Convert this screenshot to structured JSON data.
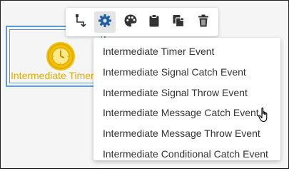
{
  "canvas": {
    "node_label": "Intermediate Timer Event",
    "node_color": "#f2c200",
    "selection_color": "#5b9bd5"
  },
  "toolbar": {
    "buttons": [
      {
        "icon": "flow-connector-icon"
      },
      {
        "icon": "gear-icon",
        "active": true
      },
      {
        "icon": "palette-icon"
      },
      {
        "icon": "clipboard-icon"
      },
      {
        "icon": "copy-icon"
      },
      {
        "icon": "trash-icon"
      }
    ]
  },
  "menu": {
    "items": [
      "Intermediate Timer Event",
      "Intermediate Signal Catch Event",
      "Intermediate Signal Throw Event",
      "Intermediate Message Catch Event",
      "Intermediate Message Throw Event",
      "Intermediate Conditional Catch Event"
    ],
    "hovered_index": 3
  }
}
